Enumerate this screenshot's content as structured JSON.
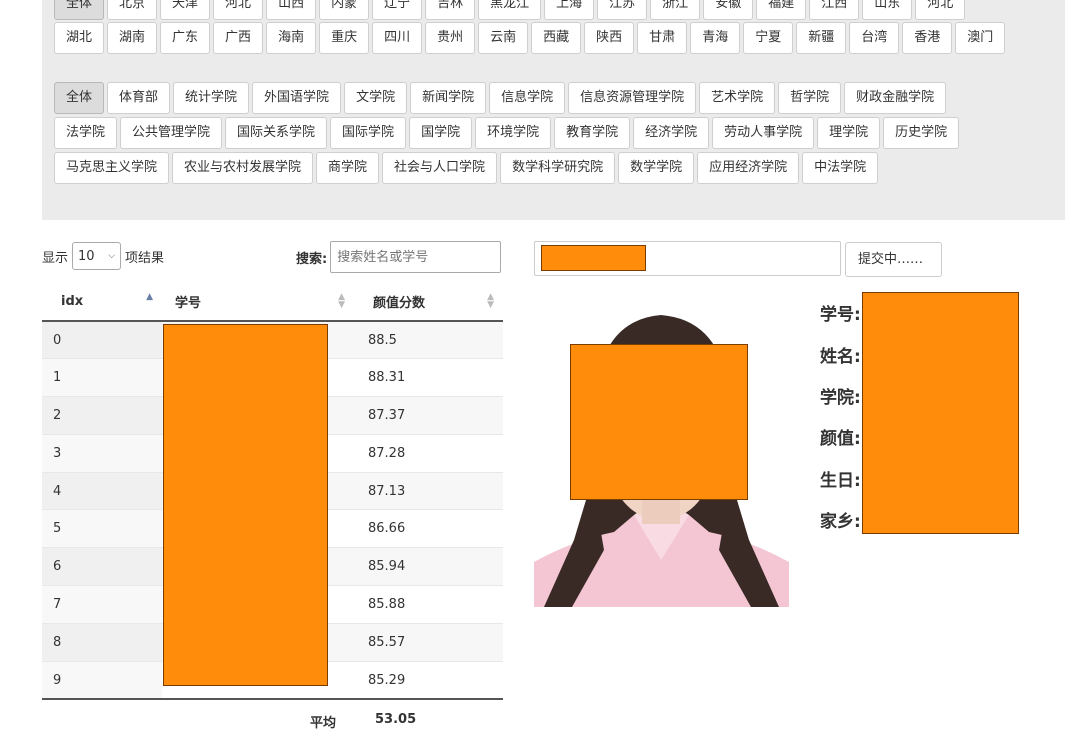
{
  "filters": {
    "provinces_row1": [
      "全体",
      "北京",
      "天津",
      "河北",
      "山西",
      "内蒙",
      "辽宁",
      "吉林",
      "黑龙江",
      "上海",
      "江苏",
      "浙江",
      "安徽",
      "福建",
      "江西",
      "山东",
      "河北"
    ],
    "provinces_row2": [
      "湖北",
      "湖南",
      "广东",
      "广西",
      "海南",
      "重庆",
      "四川",
      "贵州",
      "云南",
      "西藏",
      "陕西",
      "甘肃",
      "青海",
      "宁夏",
      "新疆",
      "台湾",
      "香港",
      "澳门"
    ],
    "colleges_row1": [
      "全体",
      "体育部",
      "统计学院",
      "外国语学院",
      "文学院",
      "新闻学院",
      "信息学院",
      "信息资源管理学院",
      "艺术学院",
      "哲学院",
      "财政金融学院"
    ],
    "colleges_row2": [
      "法学院",
      "公共管理学院",
      "国际关系学院",
      "国际学院",
      "国学院",
      "环境学院",
      "教育学院",
      "经济学院",
      "劳动人事学院",
      "理学院",
      "历史学院"
    ],
    "colleges_row3": [
      "马克思主义学院",
      "农业与农村发展学院",
      "商学院",
      "社会与人口学院",
      "数学科学研究院",
      "数学学院",
      "应用经济学院",
      "中法学院"
    ],
    "selected_province": "全体",
    "selected_college": "全体"
  },
  "table_controls": {
    "show_prefix": "显示",
    "page_length": "10",
    "show_suffix": "项结果",
    "search_label": "搜索:",
    "search_placeholder": "搜索姓名或学号"
  },
  "table": {
    "columns": [
      "idx",
      "学号",
      "颜值分数"
    ],
    "sort_column": "idx",
    "sort_direction": "ascending",
    "rows": [
      {
        "idx": "0",
        "score": "88.5"
      },
      {
        "idx": "1",
        "score": "88.31"
      },
      {
        "idx": "2",
        "score": "87.37"
      },
      {
        "idx": "3",
        "score": "87.28"
      },
      {
        "idx": "4",
        "score": "87.13"
      },
      {
        "idx": "5",
        "score": "86.66"
      },
      {
        "idx": "6",
        "score": "85.94"
      },
      {
        "idx": "7",
        "score": "85.88"
      },
      {
        "idx": "8",
        "score": "85.57"
      },
      {
        "idx": "9",
        "score": "85.29"
      }
    ],
    "footer_label": "平均",
    "footer_value": "53.05"
  },
  "submit": {
    "button_label": "提交中……"
  },
  "info": {
    "labels": [
      "学号:",
      "姓名:",
      "学院:",
      "颜值:",
      "生日:",
      "家乡:"
    ]
  },
  "colors": {
    "redaction": "#ff8c0a",
    "panel_bg": "#ebebeb",
    "shirt": "#f4c6d3",
    "hair": "#3a2a26"
  }
}
